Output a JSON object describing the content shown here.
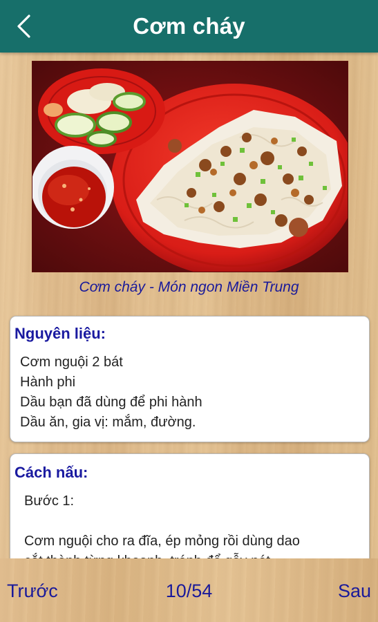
{
  "header": {
    "title": "Cơm cháy",
    "back_icon": "chevron-left-icon"
  },
  "photo": {
    "caption": "Cơm cháy - Món ngon Miền Trung"
  },
  "ingredients": {
    "heading": "Nguyên liệu:",
    "items": [
      "Cơm nguội 2 bát",
      "Hành phi",
      "Dầu bạn đã dùng để phi hành",
      "Dầu ăn, gia vị: mắm, đường."
    ]
  },
  "method": {
    "heading": "Cách nấu:",
    "step_label": "Bước 1:",
    "lines": [
      "Cơm nguội cho ra đĩa, ép mỏng rồi dùng dao",
      "cắt thành từng khoanh, tránh để gẫy nát."
    ]
  },
  "footer": {
    "prev_label": "Trước",
    "counter": "10/54",
    "next_label": "Sau"
  },
  "colors": {
    "header_bg": "#176f6a",
    "accent_text": "#1a1a9a"
  }
}
